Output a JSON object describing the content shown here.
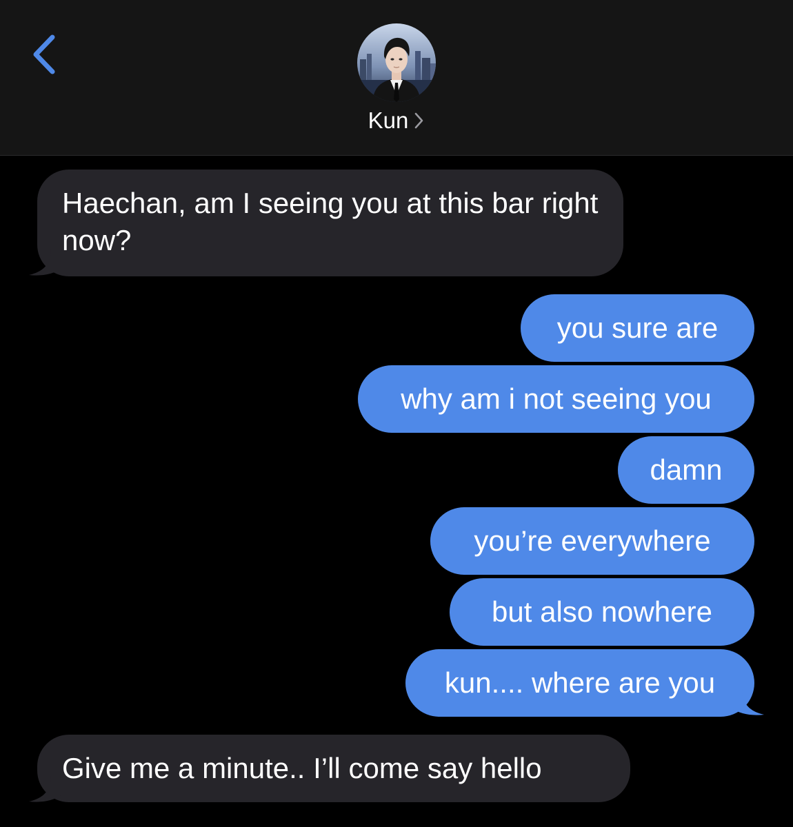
{
  "nav": {
    "contact_name": "Kun",
    "back_icon": "chevron-left-icon",
    "details_icon": "chevron-right-icon"
  },
  "colors": {
    "header_bg": "#151515",
    "background": "#000000",
    "incoming_bubble": "#26252a",
    "outgoing_bubble": "#4f89e8",
    "accent": "#4f89e8",
    "text": "#ffffff"
  },
  "messages": [
    {
      "direction": "incoming",
      "text": "Haechan, am I seeing you at this bar right now?"
    },
    {
      "direction": "outgoing",
      "text": "you sure are"
    },
    {
      "direction": "outgoing",
      "text": "why am i not seeing you"
    },
    {
      "direction": "outgoing",
      "text": "damn"
    },
    {
      "direction": "outgoing",
      "text": "you’re everywhere"
    },
    {
      "direction": "outgoing",
      "text": "but also nowhere"
    },
    {
      "direction": "outgoing",
      "text": "kun.... where are you"
    },
    {
      "direction": "incoming",
      "text": "Give me a minute.. I’ll come say hello"
    }
  ]
}
